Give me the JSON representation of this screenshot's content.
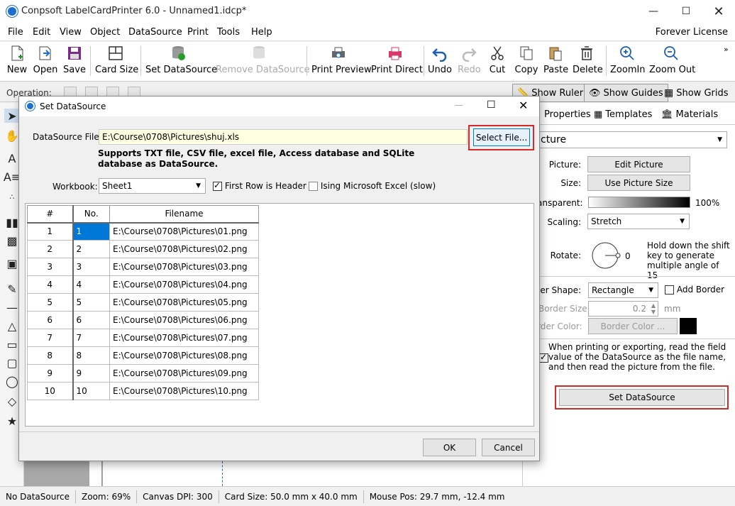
{
  "app": {
    "title": "Conpsoft LabelCardPrinter 6.0 - Unnamed1.idcp*",
    "license": "Forever License"
  },
  "menu": [
    "File",
    "Edit",
    "View",
    "Object",
    "DataSource",
    "Print",
    "Tools",
    "Help"
  ],
  "toolbar": {
    "new": "New",
    "open": "Open",
    "save": "Save",
    "card_size": "Card Size",
    "set_datasource": "Set DataSource",
    "remove_datasource": "Remove DataSource",
    "print_preview": "Print Preview",
    "print_direct": "Print Direct",
    "undo": "Undo",
    "redo": "Redo",
    "cut": "Cut",
    "copy": "Copy",
    "paste": "Paste",
    "delete": "Delete",
    "zoom_in": "ZoomIn",
    "zoom_out": "Zoom Out"
  },
  "opbar": {
    "label": "Operation:",
    "show_ruler": "Show Ruler",
    "show_guides": "Show Guides",
    "show_grids": "Show Grids"
  },
  "right_panel": {
    "tabs": {
      "properties": "Properties",
      "templates": "Templates",
      "materials": "Materials"
    },
    "object_type": "cture",
    "picture_label": "Picture:",
    "edit_picture": "Edit Picture",
    "size_label": "Size:",
    "use_picture_size": "Use Picture Size",
    "transparent_label": "ansparent:",
    "transparent_value": "100%",
    "scaling_label": "Scaling:",
    "scaling_value": "Stretch",
    "rotate_label": "Rotate:",
    "rotate_value": "0",
    "rotate_hint": "Hold down the shift key to generate multiple angle of 15",
    "border_shape_label": "rder Shape:",
    "border_shape_value": "Rectangle",
    "add_border": "Add Border",
    "border_size_label": "Border Size:",
    "border_size_value": "0.2",
    "border_size_unit": "mm",
    "border_color_label": "rder Color:",
    "border_color_button": "Border Color ...",
    "datasource_hint": "When printing or exporting, read the field value of the DataSource as the file name, and then read the picture from the file.",
    "set_datasource_button": "Set DataSource"
  },
  "status": {
    "datasource": "No DataSource",
    "zoom": "Zoom: 69%",
    "dpi": "Canvas DPI: 300",
    "card_size": "Card Size: 50.0 mm x 40.0 mm",
    "mouse_pos": "Mouse Pos: 29.7 mm, -12.4 mm"
  },
  "dialog": {
    "title": "Set DataSource",
    "file_label": "DataSource File:",
    "file_value": "E:\\Course\\0708\\Pictures\\shuj.xls",
    "select_file": "Select File...",
    "supports": "Supports TXT file, CSV file, excel file, Access database and SQLite database as DataSource.",
    "workbook_label": "Workbook:",
    "workbook_value": "Sheet1",
    "first_row_header": "First Row is Header",
    "using_excel": "Ising Microsoft Excel (slow)",
    "columns": [
      "#",
      "No.",
      "Filename"
    ],
    "rows": [
      [
        "1",
        "1",
        "E:\\Course\\0708\\Pictures\\01.png"
      ],
      [
        "2",
        "2",
        "E:\\Course\\0708\\Pictures\\02.png"
      ],
      [
        "3",
        "3",
        "E:\\Course\\0708\\Pictures\\03.png"
      ],
      [
        "4",
        "4",
        "E:\\Course\\0708\\Pictures\\04.png"
      ],
      [
        "5",
        "5",
        "E:\\Course\\0708\\Pictures\\05.png"
      ],
      [
        "6",
        "6",
        "E:\\Course\\0708\\Pictures\\06.png"
      ],
      [
        "7",
        "7",
        "E:\\Course\\0708\\Pictures\\07.png"
      ],
      [
        "8",
        "8",
        "E:\\Course\\0708\\Pictures\\08.png"
      ],
      [
        "9",
        "9",
        "E:\\Course\\0708\\Pictures\\09.png"
      ],
      [
        "10",
        "10",
        "E:\\Course\\0708\\Pictures\\10.png"
      ]
    ],
    "ok": "OK",
    "cancel": "Cancel"
  },
  "colors": {
    "highlight_red": "#d62a2a",
    "selection_blue": "#0078d7",
    "file_field_bg": "#ffffe1"
  }
}
